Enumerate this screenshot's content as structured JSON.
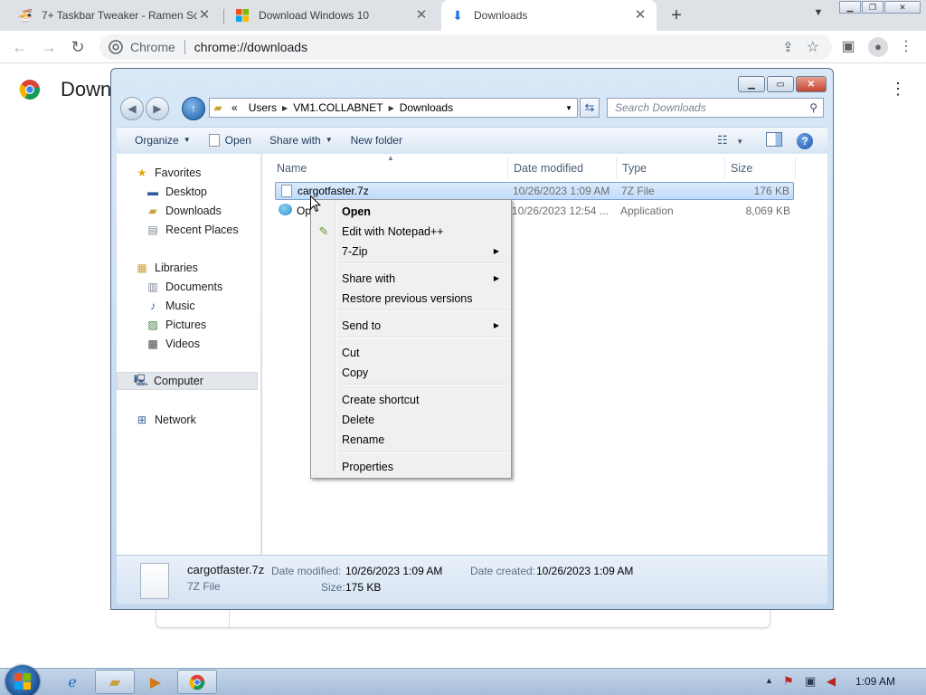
{
  "chrome": {
    "tabs": [
      {
        "title": "7+ Taskbar Tweaker - Ramen Software",
        "icon": "ramen-icon",
        "close": "✕"
      },
      {
        "title": "Download Windows 10",
        "icon": "windows-logo-icon",
        "close": "✕"
      },
      {
        "title": "Downloads",
        "icon": "download-icon",
        "close": "✕",
        "active": true
      }
    ],
    "new_tab": "+",
    "omnibox": {
      "label": "Chrome",
      "url": "chrome://downloads"
    },
    "page_title": "Down"
  },
  "explorer": {
    "address": {
      "overflow": "«",
      "crumbs": [
        "Users",
        "VM1.COLLABNET",
        "Downloads"
      ]
    },
    "search_placeholder": "Search Downloads",
    "commands": {
      "organize": "Organize",
      "open": "Open",
      "share_with": "Share with",
      "new_folder": "New folder"
    },
    "nav": {
      "favorites": {
        "label": "Favorites",
        "items": [
          "Desktop",
          "Downloads",
          "Recent Places"
        ]
      },
      "libraries": {
        "label": "Libraries",
        "items": [
          "Documents",
          "Music",
          "Pictures",
          "Videos"
        ]
      },
      "computer": "Computer",
      "network": "Network"
    },
    "columns": {
      "name": "Name",
      "date": "Date modified",
      "type": "Type",
      "size": "Size"
    },
    "files": [
      {
        "name": "cargotfaster.7z",
        "date": "10/26/2023 1:09 AM",
        "type": "7Z File",
        "size": "176 KB",
        "selected": true
      },
      {
        "name": "Op",
        "date": "10/26/2023 12:54 ...",
        "type": "Application",
        "size": "8,069 KB"
      }
    ],
    "details": {
      "name": "cargotfaster.7z",
      "type": "7Z File",
      "date_modified_label": "Date modified:",
      "date_modified": "10/26/2023 1:09 AM",
      "date_created_label": "Date created:",
      "date_created": "10/26/2023 1:09 AM",
      "size_label": "Size:",
      "size": "175 KB"
    }
  },
  "context_menu": {
    "open": "Open",
    "edit_notepad": "Edit with Notepad++",
    "seven_zip": "7-Zip",
    "share_with": "Share with",
    "restore": "Restore previous versions",
    "send_to": "Send to",
    "cut": "Cut",
    "copy": "Copy",
    "create_shortcut": "Create shortcut",
    "delete": "Delete",
    "rename": "Rename",
    "properties": "Properties"
  },
  "taskbar": {
    "clock": "1:09 AM"
  },
  "colors": {
    "selection": "#c1dbfc",
    "chrome_tabstrip": "#dee1e6",
    "taskbar": "#a6bed9"
  }
}
